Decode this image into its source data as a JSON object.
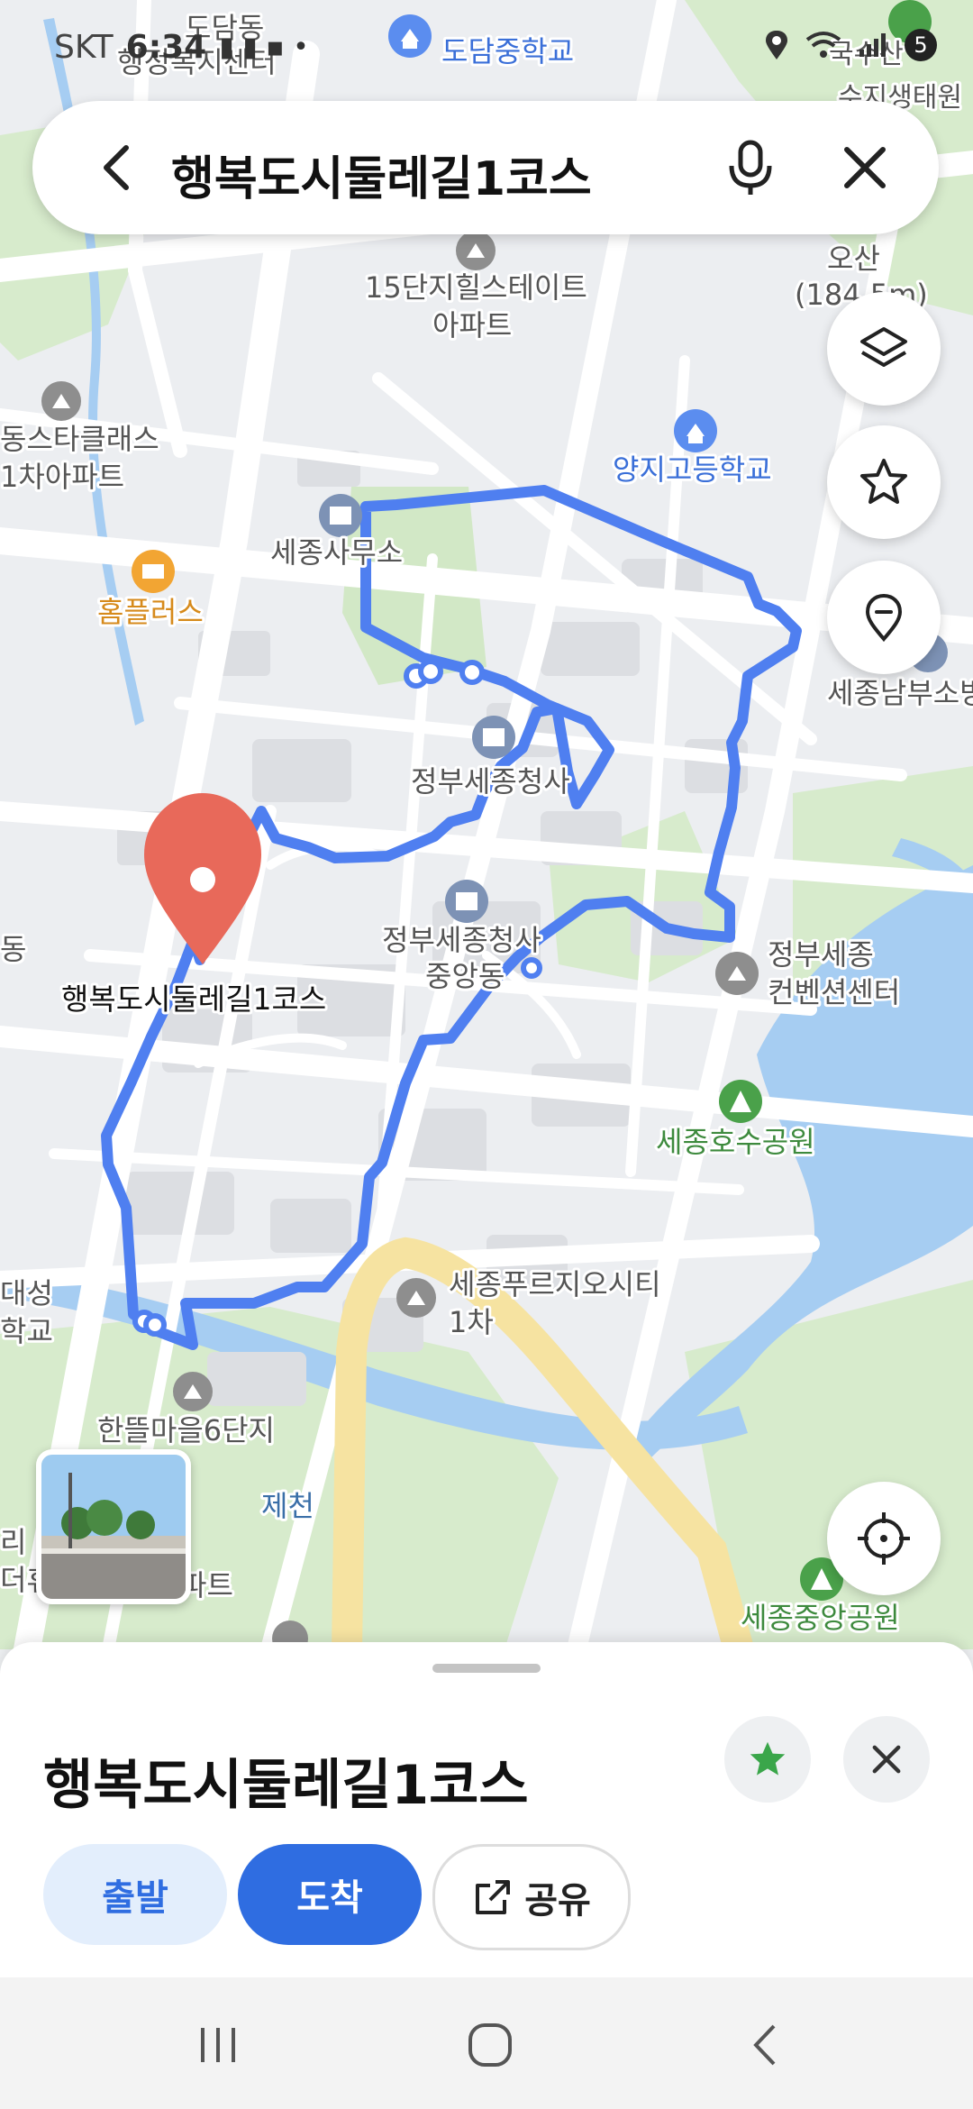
{
  "status_bar": {
    "carrier": "SKT",
    "time": "6:34",
    "notification_count": "5"
  },
  "search": {
    "query": "행복도시둘레길1코스"
  },
  "map": {
    "labels": {
      "dodamdong": "도담동",
      "dodam_welfare": "행정복지센터",
      "dodam_middle": "도담중학교",
      "hill_state_1": "15단지힐스테이트",
      "hill_state_2": "아파트",
      "osan_1": "오산",
      "osan_2": "(184.5m)",
      "star_class_1": "동스타클래스",
      "star_class_2": "1차아파트",
      "yangji_high": "양지고등학교",
      "sejong_office": "세종사무소",
      "homeplus": "홈플러스",
      "sejong_south": "세종남부소방",
      "gov_complex": "정부세종청사",
      "gov_central_1": "정부세종청사",
      "gov_central_2": "중앙동",
      "convention_1": "정부세종",
      "convention_2": "컨벤션센터",
      "lake_park": "세종호수공원",
      "place_name": "행복도시둘레길1코스",
      "dong_left": "동",
      "pergio_1": "세종푸르지오시티",
      "pergio_2": "1차",
      "daeseong_1": "대성",
      "daeseong_2": "학교",
      "hantteul": "한뜰마을6단지",
      "jecheon": "제천",
      "central_park": "세종중앙공원",
      "left_bottom_1": "리",
      "left_bottom_2": "더휴",
      "left_bottom_3": "파트",
      "top_right_1": "국수산",
      "top_right_2": "수지생태원"
    }
  },
  "sheet": {
    "title": "행복도시둘레길1코스",
    "start_label": "출발",
    "arrive_label": "도착",
    "share_label": "공유"
  },
  "colors": {
    "route": "#4f7ff0",
    "accent": "#2f6de1",
    "pin": "#e8695a",
    "park": "#d7ebcc",
    "water": "#a6cdf2"
  },
  "icons": {
    "back": "chevron-left-icon",
    "mic": "microphone-icon",
    "close": "close-icon",
    "layers": "layers-icon",
    "favorite": "star-icon",
    "location_pin": "location-pin-icon",
    "my_location": "crosshair-icon",
    "share": "share-icon",
    "saved": "star-filled-icon"
  }
}
